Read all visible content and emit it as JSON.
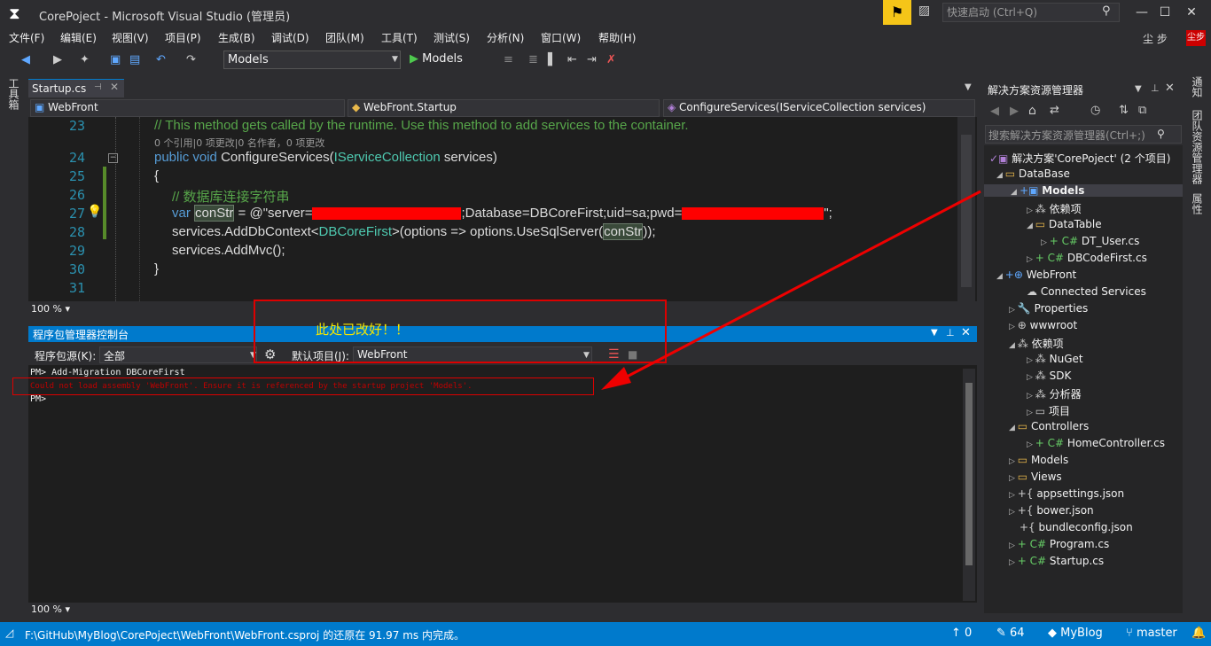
{
  "title_bar": {
    "title": "CorePoject - Microsoft Visual Studio (管理员)",
    "quick_launch": "快速启动 (Ctrl+Q)"
  },
  "menu": [
    "文件(F)",
    "编辑(E)",
    "视图(V)",
    "项目(P)",
    "生成(B)",
    "调试(D)",
    "团队(M)",
    "工具(T)",
    "测试(S)",
    "分析(N)",
    "窗口(W)",
    "帮助(H)"
  ],
  "user": {
    "name": "尘 步",
    "badge": "尘步"
  },
  "toolbar": {
    "config": "Models",
    "run": "Models"
  },
  "left_strip": {
    "toolbox": "工具箱"
  },
  "right_strip": [
    "通知",
    "团队资源管理器",
    "属性"
  ],
  "editor": {
    "tab": "Startup.cs",
    "nav_project": "WebFront",
    "nav_class": "WebFront.Startup",
    "nav_member": "ConfigureServices(IServiceCollection services)",
    "line_numbers": [
      "23",
      "24",
      "25",
      "26",
      "27",
      "28",
      "29",
      "30",
      "31"
    ],
    "comment_summary": "// This method gets called by the runtime. Use this method to add services to the container.",
    "codelens": "0 个引用|0 项更改|0 名作者，0 项更改",
    "l24_kw1": "public",
    "l24_kw2": "void",
    "l24_name": "ConfigureServices(",
    "l24_type": "IServiceCollection",
    "l24_rest": " services)",
    "l25": "{",
    "l26_comment": "// 数据库连接字符串",
    "l27_kw": "var",
    "l27_var": "conStr",
    "l27_a": " = @\"server=",
    "l27_b": ";Database=DBCoreFirst;uid=sa;pwd=",
    "l27_c": "\";",
    "l28_a": "services.AddDbContext<",
    "l28_type": "DBCoreFirst",
    "l28_b": ">(options => options.UseSqlServer(",
    "l28_var": "conStr",
    "l28_c": "));",
    "l29": "services.AddMvc();",
    "l30": "}",
    "zoom": "100 %"
  },
  "pmc": {
    "title": "程序包管理器控制台",
    "source_label": "程序包源(K):",
    "source_value": "全部",
    "default_project_label": "默认项目(J):",
    "default_project_value": "WebFront",
    "lines": [
      "PM> Add-Migration DBCoreFirst",
      "Could not load assembly 'WebFront'. Ensure it is referenced by the startup project 'Models'.",
      "PM>"
    ],
    "zoom": "100 %"
  },
  "annotation": {
    "text": "此处已改好！！"
  },
  "solution_explorer": {
    "title": "解决方案资源管理器",
    "search": "搜索解决方案资源管理器(Ctrl+;)",
    "items": [
      "解决方案'CorePoject' (2 个项目)",
      "DataBase",
      "Models",
      "依赖项",
      "DataTable",
      "DT_User.cs",
      "DBCodeFirst.cs",
      "WebFront",
      "Connected Services",
      "Properties",
      "wwwroot",
      "依赖项",
      "NuGet",
      "SDK",
      "分析器",
      "项目",
      "Controllers",
      "HomeController.cs",
      "Models",
      "Views",
      "appsettings.json",
      "bower.json",
      "bundleconfig.json",
      "Program.cs",
      "Startup.cs"
    ]
  },
  "status": {
    "message": "F:\\GitHub\\MyBlog\\CorePoject\\WebFront\\WebFront.csproj 的还原在 91.97 ms 内完成。",
    "up": "0",
    "edits": "64",
    "repo": "MyBlog",
    "branch": "master"
  },
  "colors": {
    "accent": "#007acc",
    "background": "#2d2d30",
    "editor_bg": "#1e1e1e",
    "annotation": "#dd0000"
  }
}
